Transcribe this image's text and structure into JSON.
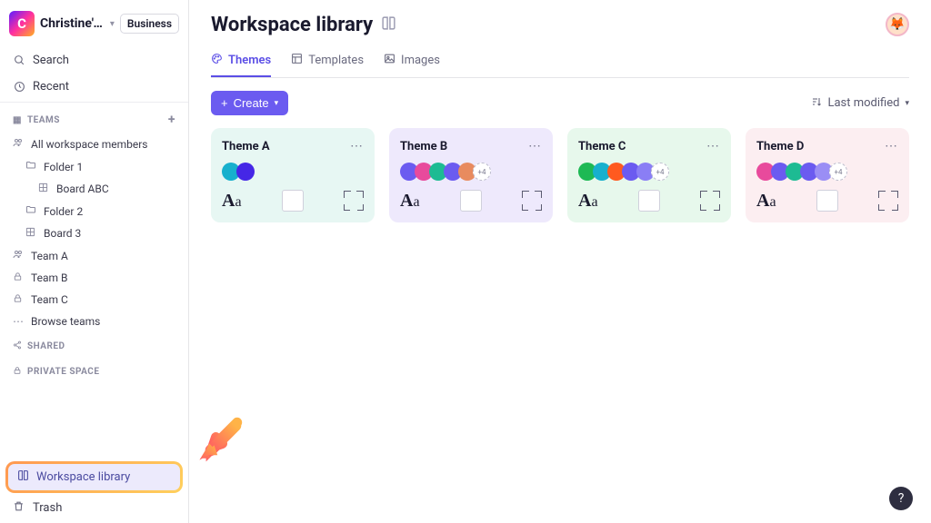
{
  "workspace": {
    "name": "Christine's…",
    "plan": "Business",
    "logo_letter": "C"
  },
  "sidebar": {
    "search": "Search",
    "recent": "Recent",
    "teams_header": "TEAMS",
    "all_members": "All workspace members",
    "folder1": "Folder 1",
    "board_abc": "Board ABC",
    "folder2": "Folder 2",
    "board3": "Board 3",
    "team_a": "Team A",
    "team_b": "Team B",
    "team_c": "Team C",
    "browse_teams": "Browse teams",
    "shared_header": "SHARED",
    "private_header": "PRIVATE SPACE",
    "workspace_library": "Workspace library",
    "trash": "Trash"
  },
  "page": {
    "title": "Workspace library"
  },
  "tabs": {
    "themes": "Themes",
    "templates": "Templates",
    "images": "Images"
  },
  "toolbar": {
    "create": "Create",
    "sort": "Last modified"
  },
  "cards": [
    {
      "title": "Theme A",
      "bg": "#e7f7f3",
      "swatches": [
        "#17b0cd",
        "#4527e6"
      ],
      "extra": null
    },
    {
      "title": "Theme B",
      "bg": "#eee9fc",
      "swatches": [
        "#6b5bf0",
        "#e84a9c",
        "#1dbb93",
        "#6b5bf0",
        "#e88b5f"
      ],
      "extra": "+4"
    },
    {
      "title": "Theme C",
      "bg": "#e7f8ec",
      "swatches": [
        "#1db954",
        "#17b0cd",
        "#ff5a1f",
        "#6b5bf0",
        "#8a7ef5"
      ],
      "extra": "+4"
    },
    {
      "title": "Theme D",
      "bg": "#fceef1",
      "swatches": [
        "#e84a9c",
        "#6b5bf0",
        "#1dbb93",
        "#6b5bf0",
        "#9a8ef5"
      ],
      "extra": "+4"
    }
  ],
  "help": "?"
}
